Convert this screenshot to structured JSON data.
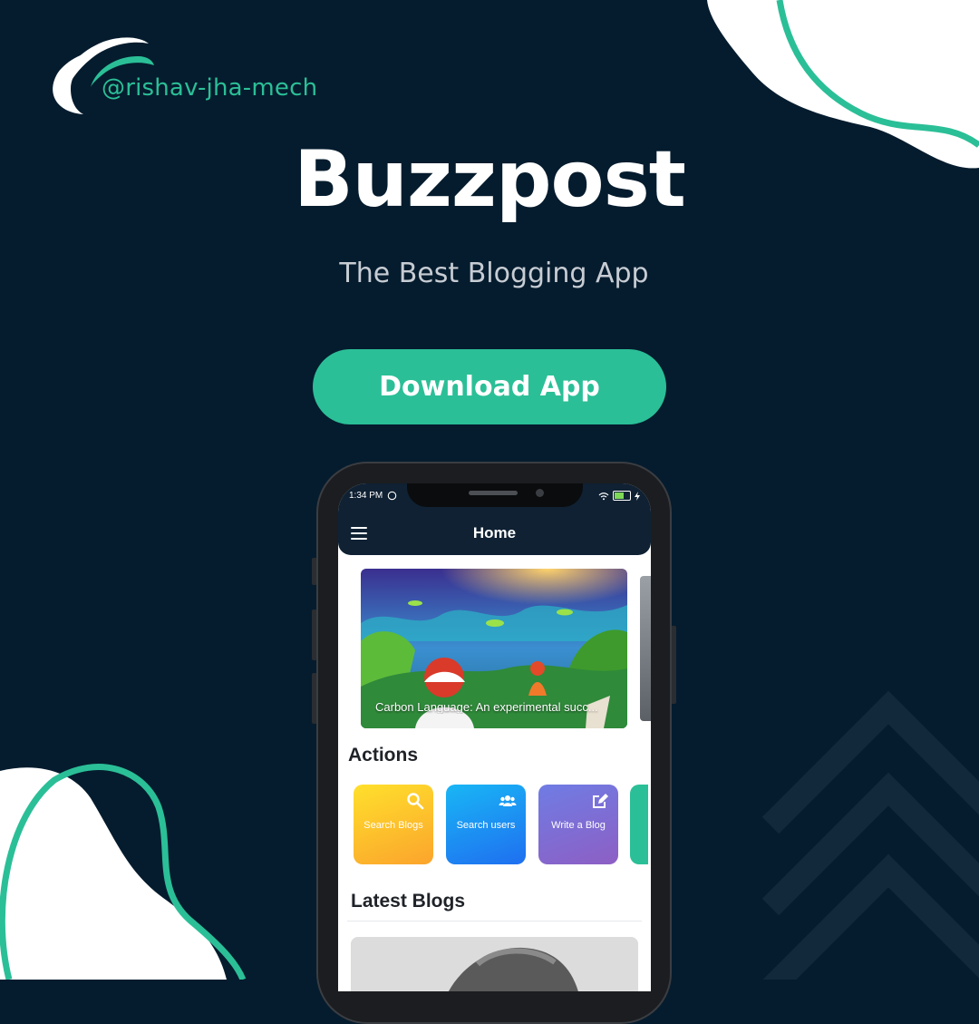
{
  "brand": {
    "handle": "@rishav-jha-mech",
    "logo_icon": "swoosh-logo-icon"
  },
  "headline": {
    "title": "Buzzpost",
    "tagline": "The Best Blogging App"
  },
  "cta": {
    "label": "Download App"
  },
  "phone": {
    "status_bar": {
      "time": "1:34 PM",
      "icons": [
        "whatsapp-icon",
        "wifi-icon",
        "battery-icon",
        "charging-icon"
      ]
    },
    "app_bar": {
      "title": "Home",
      "menu_icon": "hamburger-menu-icon"
    },
    "featured": {
      "caption": "Carbon Language: An experimental succ..."
    },
    "actions": {
      "heading": "Actions",
      "items": [
        {
          "label": "Search Blogs",
          "icon": "search-icon"
        },
        {
          "label": "Search users",
          "icon": "users-icon"
        },
        {
          "label": "Write a Blog",
          "icon": "edit-icon"
        }
      ]
    },
    "latest": {
      "heading": "Latest Blogs"
    }
  },
  "colors": {
    "background": "#051c2e",
    "accent": "#2bbf97",
    "app_bar": "#0f2133",
    "tile_search_blogs": "#fdb92c",
    "tile_search_users": "#1f8ff5",
    "tile_write_blog": "#7e6ad6"
  }
}
